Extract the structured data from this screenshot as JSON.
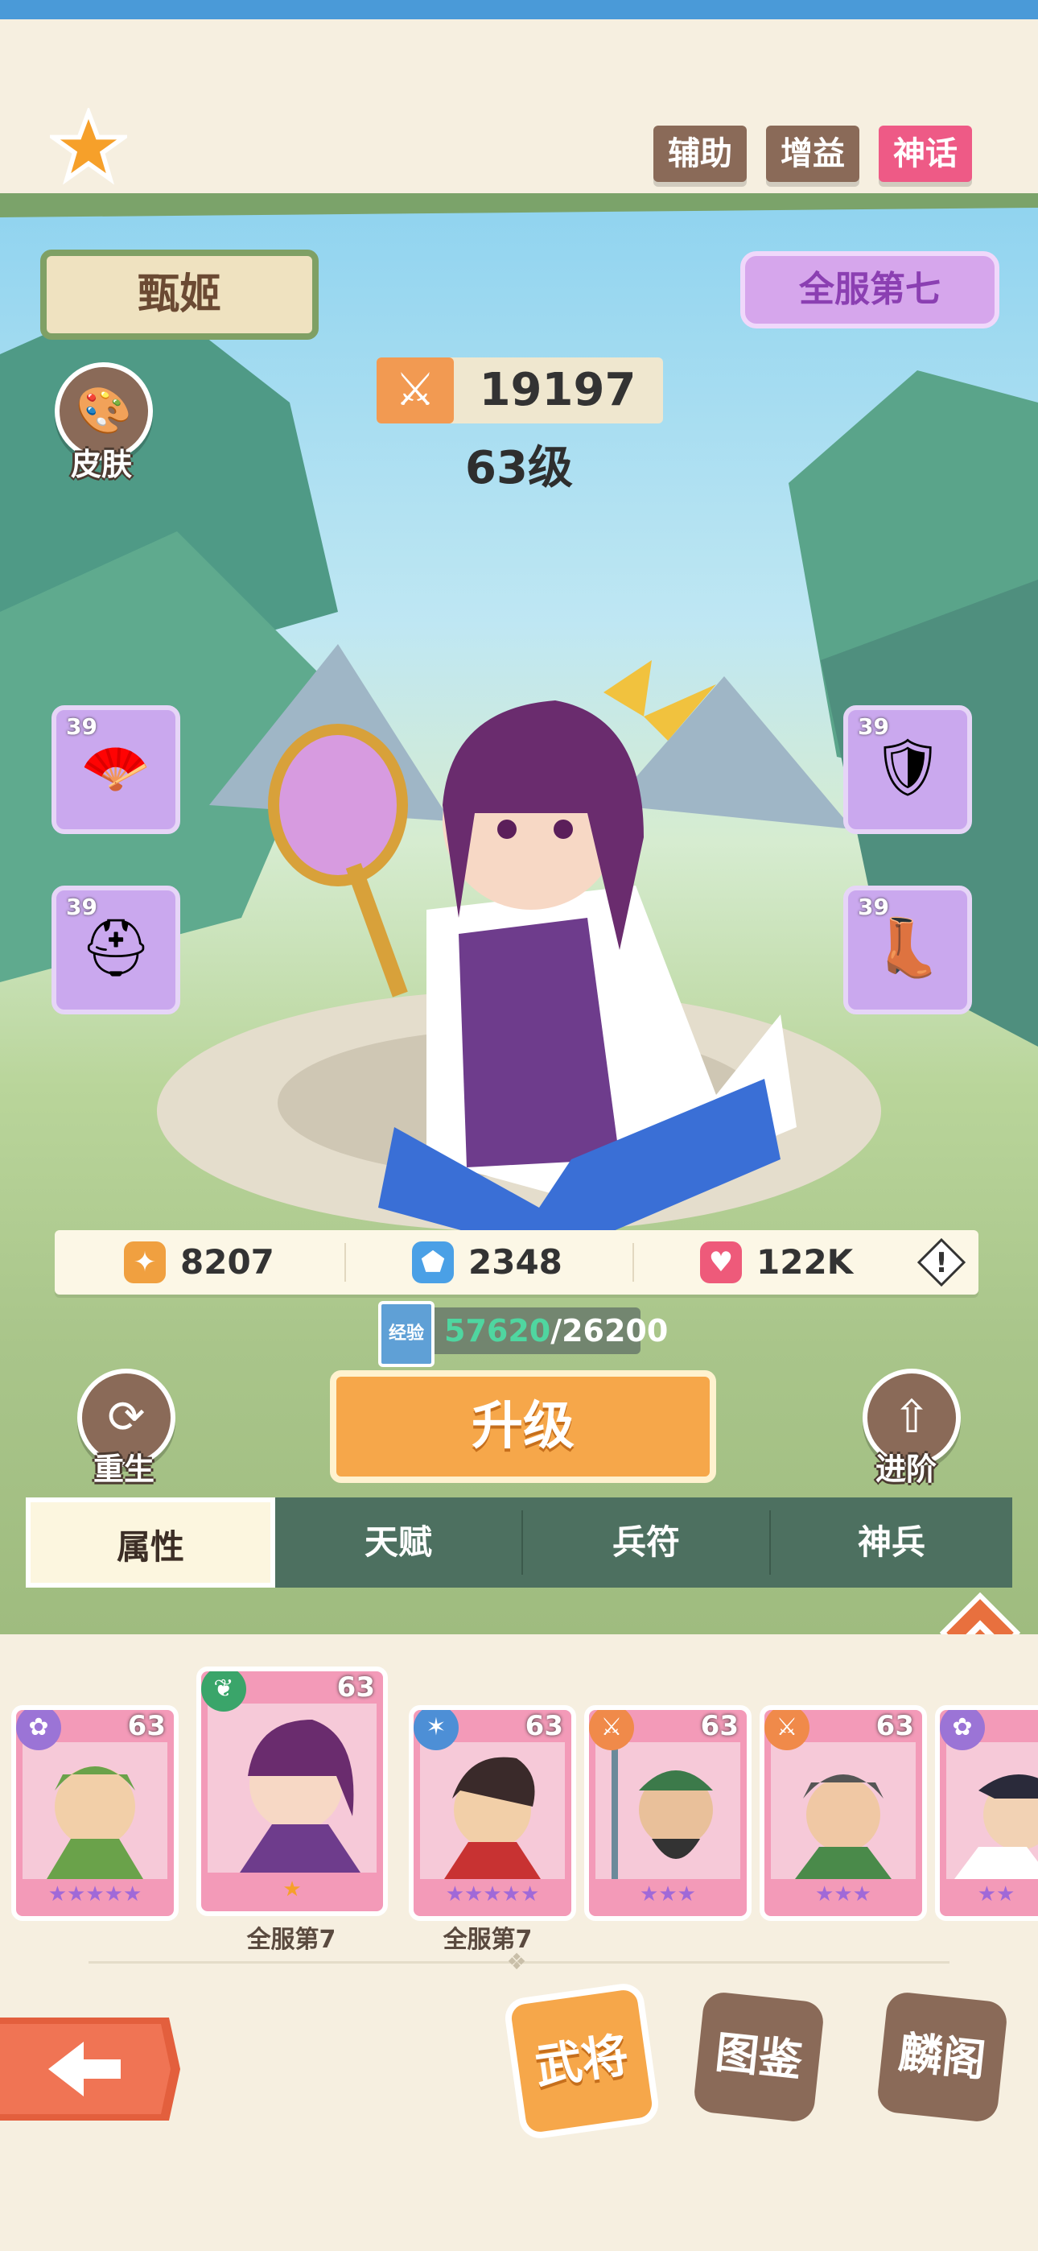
{
  "header": {
    "tags": [
      {
        "label": "辅助",
        "color": "#8a6a58"
      },
      {
        "label": "增益",
        "color": "#8a6a58"
      },
      {
        "label": "神话",
        "color": "#ee5a86"
      }
    ],
    "star_icon": "star-icon"
  },
  "hero": {
    "name": "甄姬",
    "server_rank": "全服第七",
    "power": "19197",
    "level": "63级"
  },
  "side_buttons": {
    "skin": "皮肤",
    "rebirth": "重生",
    "advance": "进阶"
  },
  "equipment": [
    {
      "level": "39",
      "icon": "fan-icon"
    },
    {
      "level": "39",
      "icon": "armor-icon"
    },
    {
      "level": "39",
      "icon": "helmet-icon"
    },
    {
      "level": "39",
      "icon": "boots-icon"
    }
  ],
  "stats": {
    "attack": "8207",
    "defense": "2348",
    "hp": "122K"
  },
  "exp": {
    "label": "经验",
    "current": "57620",
    "separator": "/",
    "required": "26200"
  },
  "upgrade_label": "升级",
  "tabs": [
    "属性",
    "天赋",
    "兵符",
    "神兵"
  ],
  "roster": [
    {
      "level": "63",
      "caption": "",
      "badge_color": "#9b74d6"
    },
    {
      "level": "63",
      "caption": "全服第7",
      "badge_color": "#3aa56a"
    },
    {
      "level": "63",
      "caption": "全服第7",
      "badge_color": "#4d8fd6"
    },
    {
      "level": "63",
      "caption": "",
      "badge_color": "#f08a4a"
    },
    {
      "level": "63",
      "caption": "",
      "badge_color": "#f08a4a"
    },
    {
      "level": "",
      "caption": "",
      "badge_color": "#9b74d6"
    }
  ],
  "bottom_nav": {
    "heroes": "武将",
    "codex": "图鉴",
    "pavilion": "麟阁"
  },
  "colors": {
    "accent_orange": "#f6a74a",
    "mythic_pink": "#ee5a86",
    "tag_brown": "#8a6a58",
    "exp_green": "#4fd6a0"
  }
}
